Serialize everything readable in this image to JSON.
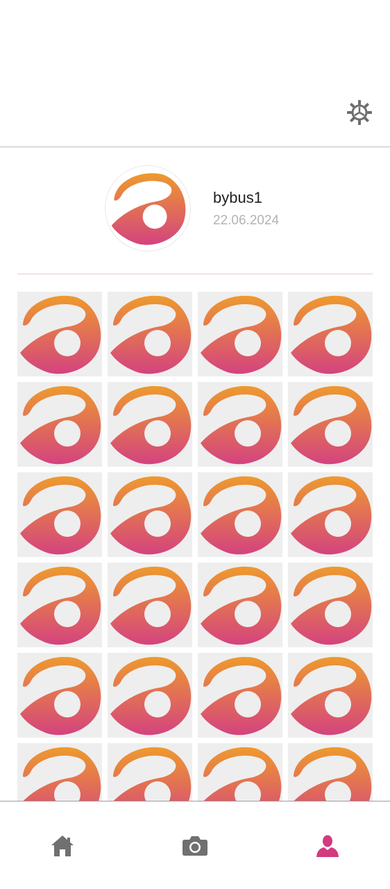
{
  "profile": {
    "username": "bybus1",
    "joined": "22.06.2024"
  },
  "icons": {
    "settings": "gear-icon",
    "home": "home-icon",
    "camera": "camera-icon",
    "profile": "person-icon"
  },
  "grid": {
    "tile_count": 24,
    "tile_image": "app-logo"
  },
  "colors": {
    "logo_top": "#ee9a2e",
    "logo_bottom": "#d4437f",
    "nav_inactive": "#707070",
    "nav_active": "#d33a7f",
    "divider": "#f3c6cf",
    "tile_bg": "#eeeeee"
  },
  "bottom_nav": {
    "items": [
      {
        "name": "home",
        "active": false
      },
      {
        "name": "camera",
        "active": false
      },
      {
        "name": "profile",
        "active": true
      }
    ]
  }
}
